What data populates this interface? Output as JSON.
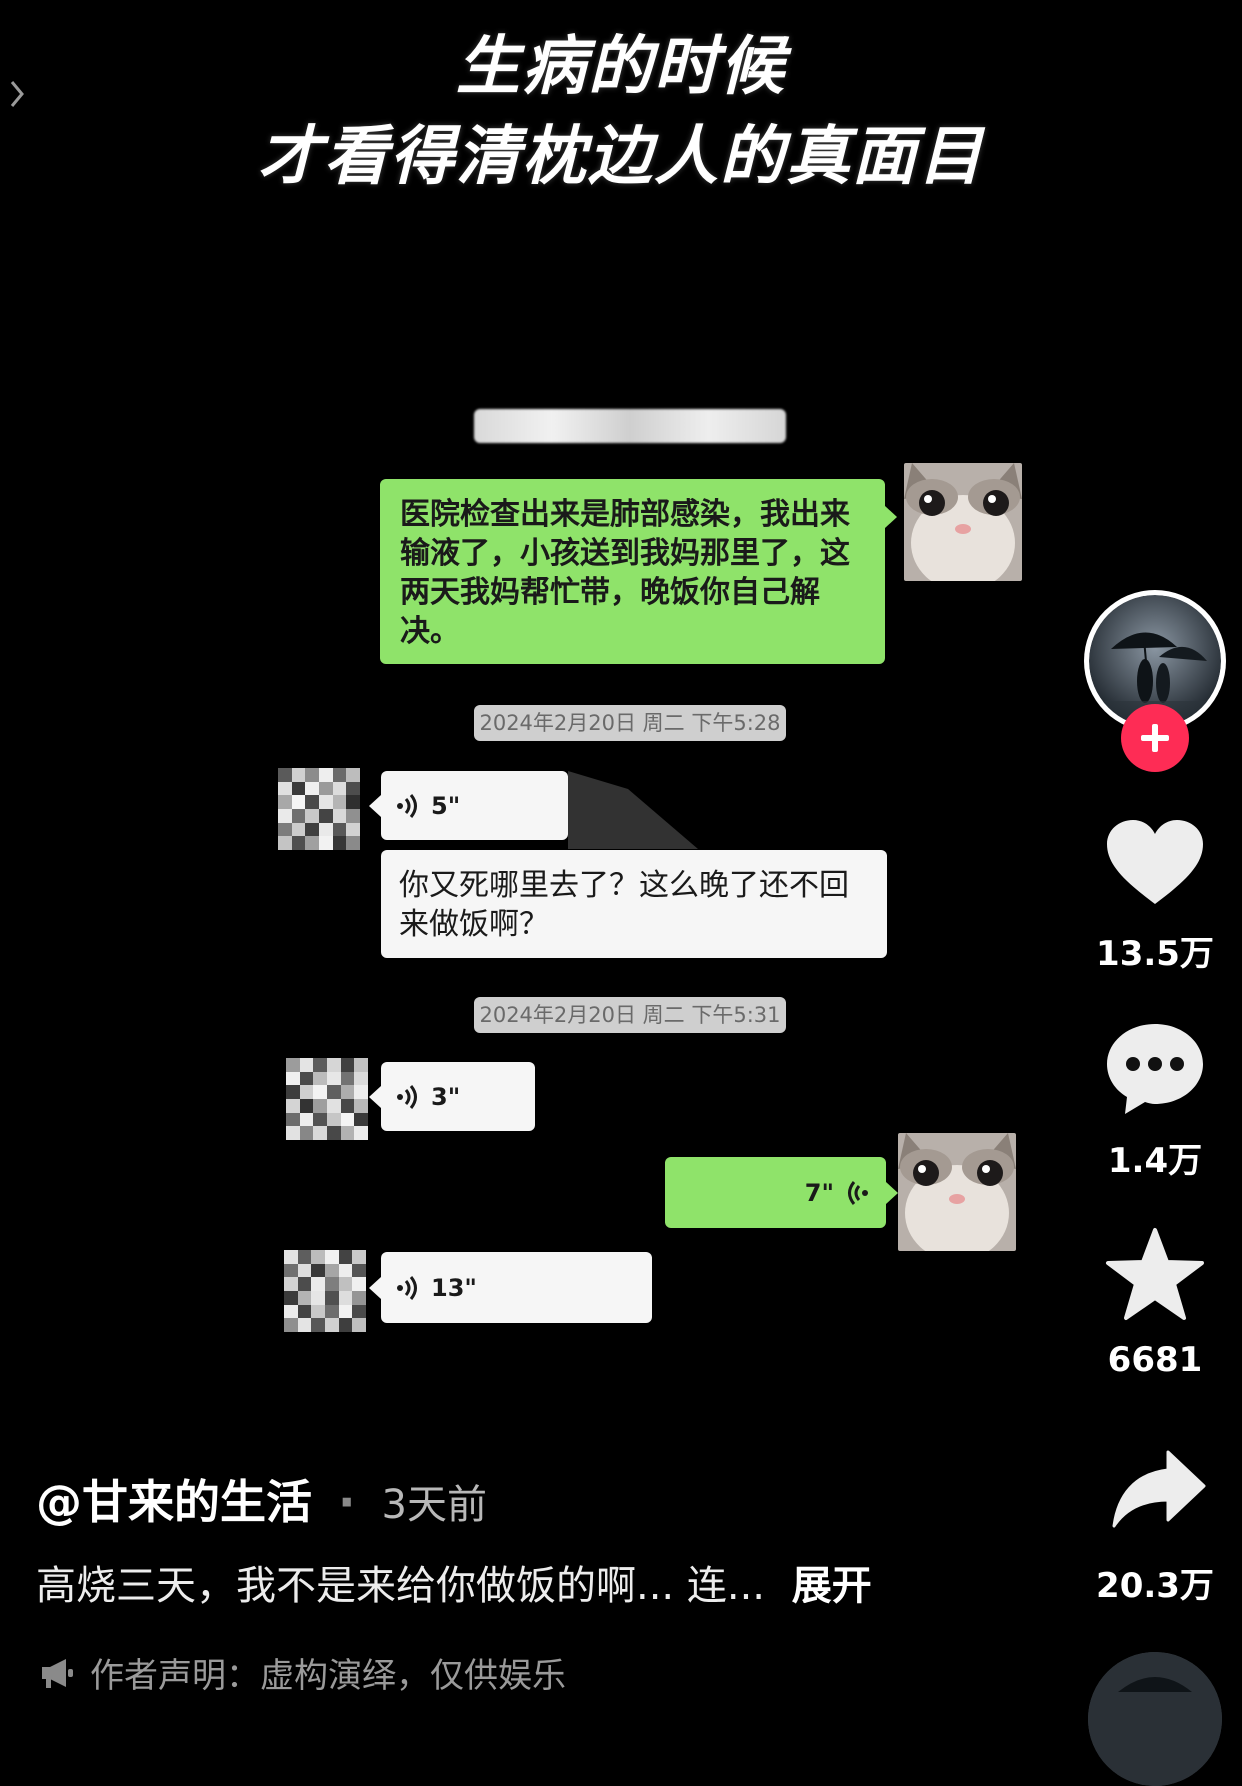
{
  "title": {
    "line1": "生病的时候",
    "line2": "才看得清枕边人的真面目"
  },
  "chat": {
    "msg1": "医院检查出来是肺部感染，我出来输液了，小孩送到我妈那里了，这两天我妈帮忙带，晚饭你自己解决。",
    "timestamp1": "2024年2月20日 周二 下午5:28",
    "voice1": "5\"",
    "msg2": "你又死哪里去了？这么晚了还不回来做饭啊？",
    "timestamp2": "2024年2月20日 周二 下午5:31",
    "voice2": "3\"",
    "voice3_self": "7\"",
    "voice4": "13\""
  },
  "rail": {
    "like_count": "13.5万",
    "comment_count": "1.4万",
    "favorite_count": "6681",
    "share_count": "20.3万"
  },
  "post": {
    "author": "@甘来的生活",
    "separator": "·",
    "time_ago": "3天前",
    "caption": "高烧三天，我不是来给你做饭的啊... 连...",
    "expand_label": "展开",
    "disclaimer": "作者声明：虚构演绎，仅供娱乐"
  },
  "colors": {
    "chat_green": "#8fe36a",
    "follow_red": "#fe2c55",
    "background": "#000000"
  }
}
